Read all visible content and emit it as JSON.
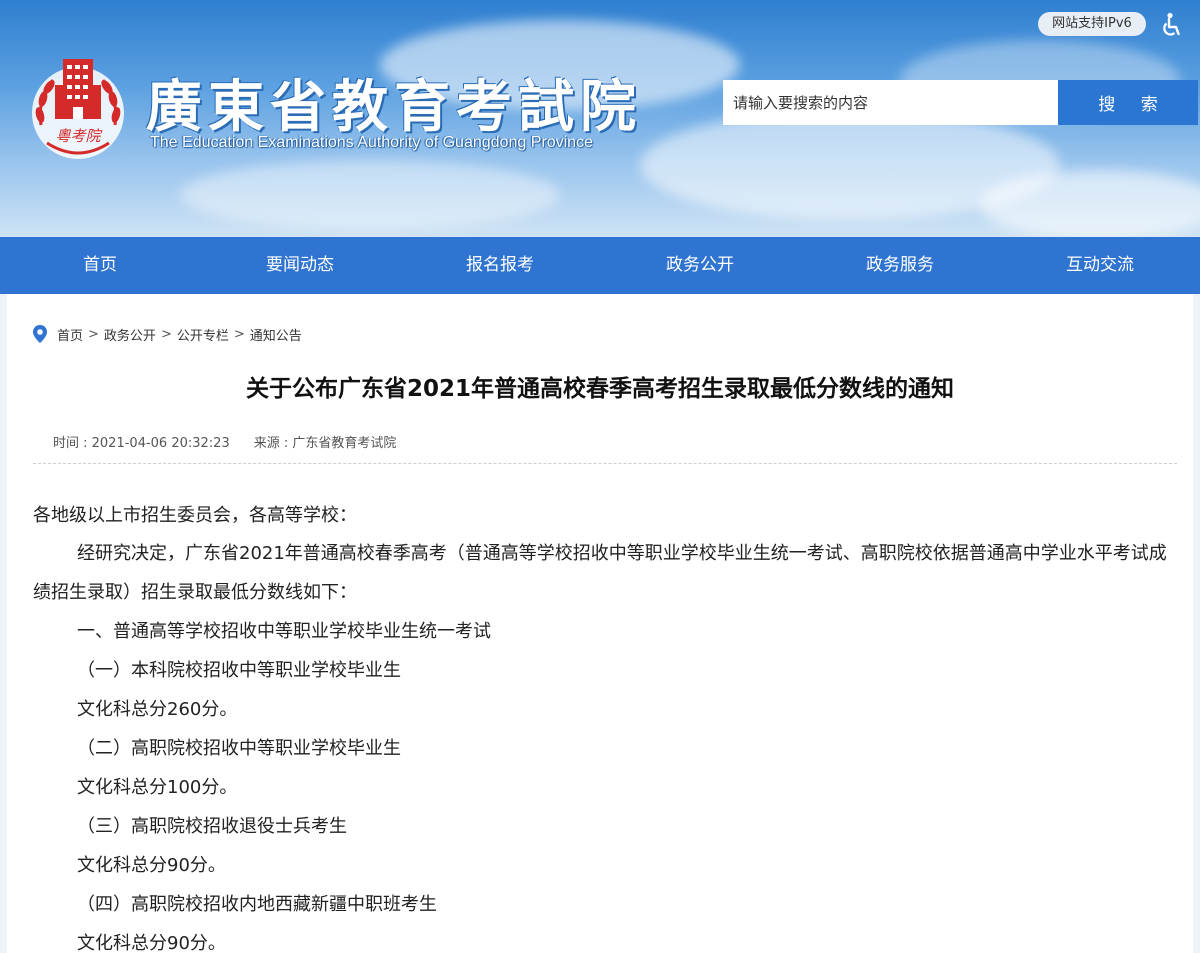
{
  "header": {
    "site_title": "廣東省教育考試院",
    "site_subtitle": "The Education Examinations Authority of Guangdong Province",
    "emblem_text": "粵考院",
    "ipv6_badge": "网站支持IPv6",
    "accessibility_icon": "accessibility-icon",
    "search": {
      "placeholder": "请输入要搜索的内容",
      "button_label": "搜 索"
    }
  },
  "nav": {
    "items": [
      "首页",
      "要闻动态",
      "报名报考",
      "政务公开",
      "政务服务",
      "互动交流"
    ]
  },
  "breadcrumb": {
    "icon": "location-pin-icon",
    "items": [
      "首页",
      "政务公开",
      "公开专栏",
      "通知公告"
    ],
    "separator": ">"
  },
  "article": {
    "title": "关于公布广东省2021年普通高校春季高考招生录取最低分数线的通知",
    "time": "时间 : 2021-04-06 20:32:23",
    "source": "来源 : 广东省教育考试院",
    "paragraphs": [
      "各地级以上市招生委员会，各高等学校：",
      "经研究决定，广东省2021年普通高校春季高考（普通高等学校招收中等职业学校毕业生统一考试、高职院校依据普通高中学业水平考试成绩招生录取）招生录取最低分数线如下：",
      "一、普通高等学校招收中等职业学校毕业生统一考试",
      "（一）本科院校招收中等职业学校毕业生",
      "文化科总分260分。",
      "（二）高职院校招收中等职业学校毕业生",
      "文化科总分100分。",
      "（三）高职院校招收退役士兵考生",
      "文化科总分90分。",
      "（四）高职院校招收内地西藏新疆中职班考生",
      "文化科总分90分。"
    ]
  },
  "colors": {
    "nav_bg": "#2f74d0",
    "search_button": "#2a76d2",
    "emblem_red": "#d42a2a"
  }
}
